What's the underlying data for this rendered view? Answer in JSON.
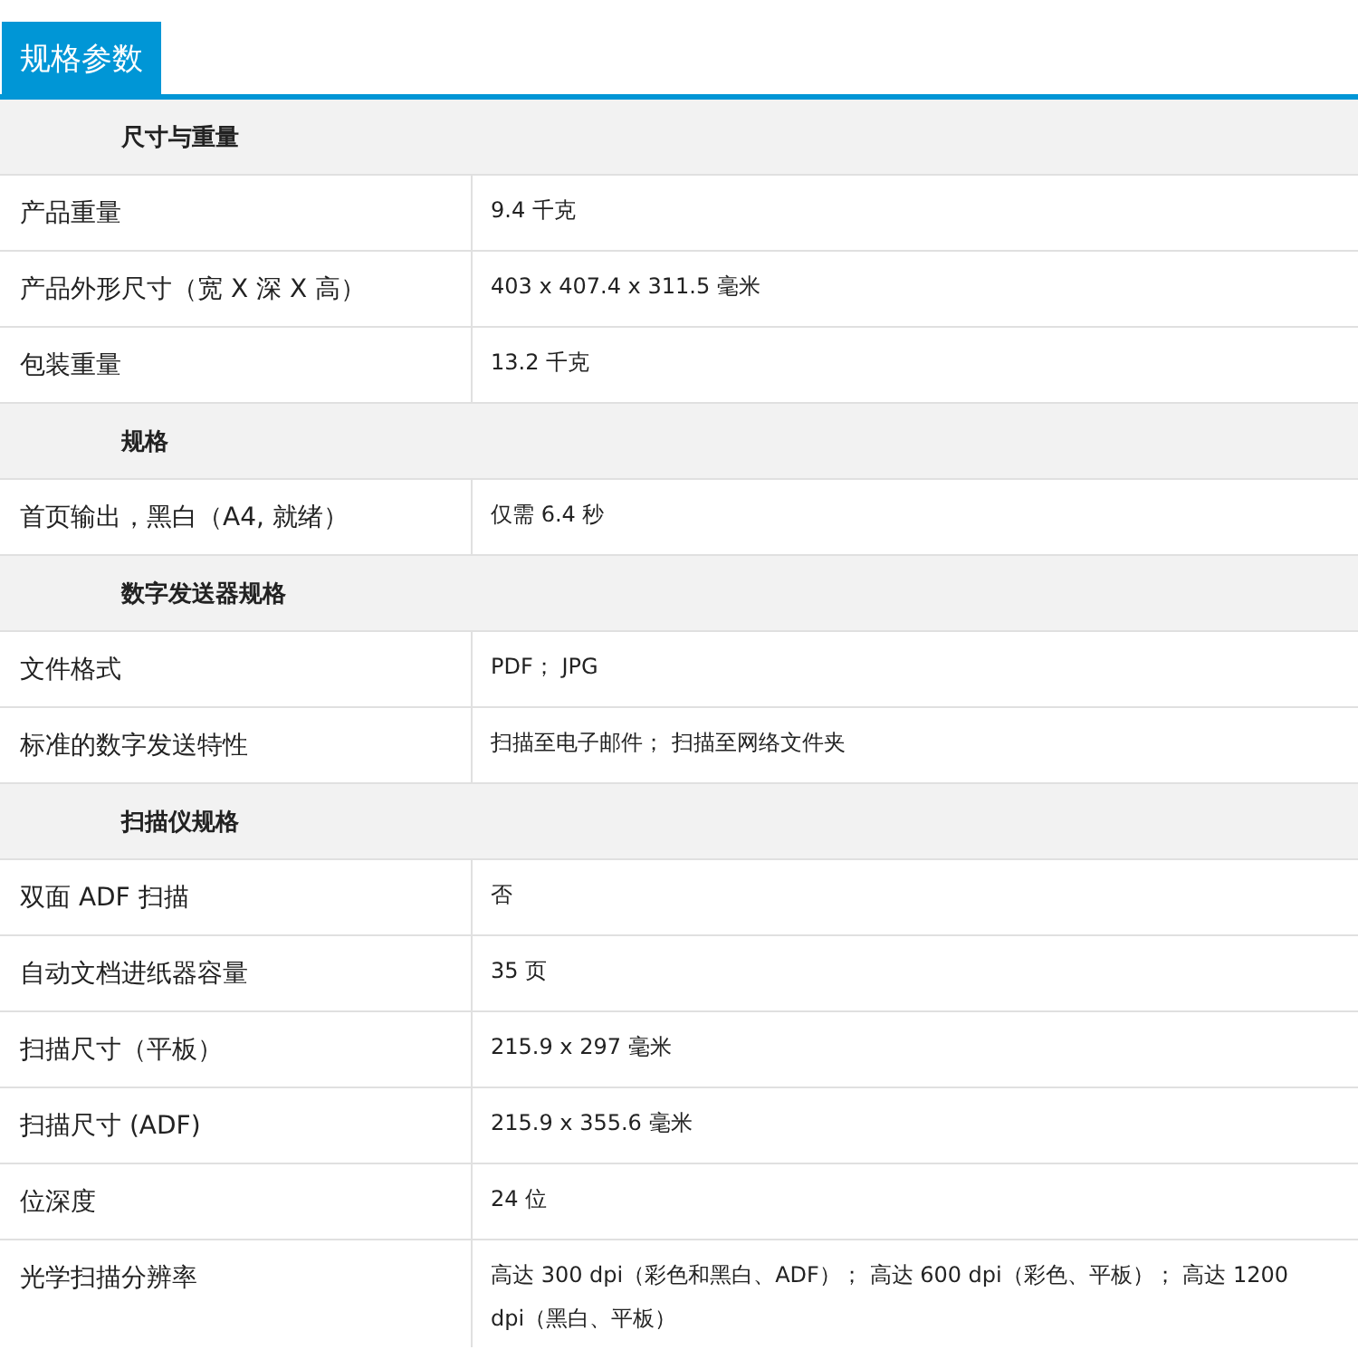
{
  "tab": {
    "label": "规格参数",
    "selected": true
  },
  "rows": [
    {
      "kind": "section",
      "label": "尺寸与重量"
    },
    {
      "kind": "row",
      "label": "产品重量",
      "value": "9.4 千克"
    },
    {
      "kind": "row",
      "label": "产品外形尺寸（宽 X 深 X 高）",
      "value": "403 x 407.4 x 311.5 毫米"
    },
    {
      "kind": "row",
      "label": "包装重量",
      "value": "13.2 千克"
    },
    {
      "kind": "section",
      "label": "规格"
    },
    {
      "kind": "row",
      "label": "首页输出，黑白（A4, 就绪）",
      "value": "仅需 6.4 秒"
    },
    {
      "kind": "section",
      "label": "数字发送器规格"
    },
    {
      "kind": "row",
      "label": "文件格式",
      "value": "PDF； JPG"
    },
    {
      "kind": "row",
      "label": "标准的数字发送特性",
      "value": "扫描至电子邮件； 扫描至网络文件夹"
    },
    {
      "kind": "section",
      "label": "扫描仪规格"
    },
    {
      "kind": "row",
      "label": "双面 ADF 扫描",
      "value": "否"
    },
    {
      "kind": "row",
      "label": "自动文档进纸器容量",
      "value": "35 页"
    },
    {
      "kind": "row",
      "label": "扫描尺寸（平板）",
      "value": "215.9 x 297 毫米"
    },
    {
      "kind": "row",
      "label": "扫描尺寸 (ADF)",
      "value": "215.9 x 355.6 毫米"
    },
    {
      "kind": "row",
      "label": "位深度",
      "value": "24 位"
    },
    {
      "kind": "row",
      "label": "光学扫描分辨率",
      "value": "高达 300 dpi（彩色和黑白、ADF）； 高达 600 dpi（彩色、平板）； 高达 1200 dpi（黑白、平板）"
    }
  ]
}
